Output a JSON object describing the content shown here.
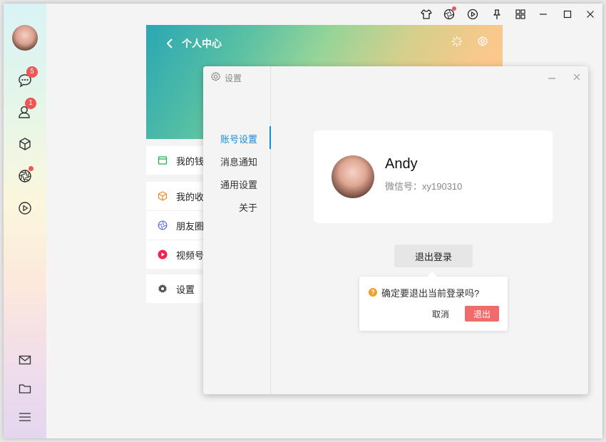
{
  "window": {
    "titlebar_icons": [
      "shirt-icon",
      "aperture-icon",
      "play-circle-icon",
      "pin-icon",
      "grid-icon",
      "minimize-icon",
      "maximize-icon",
      "close-icon"
    ]
  },
  "sidebar": {
    "items": [
      {
        "icon": "chat-icon",
        "badge": "5"
      },
      {
        "icon": "contacts-icon",
        "badge": "1"
      },
      {
        "icon": "cube-icon"
      },
      {
        "icon": "aperture-icon"
      },
      {
        "icon": "play-circle-icon"
      }
    ],
    "bottom_items": [
      {
        "icon": "mail-icon"
      },
      {
        "icon": "folder-icon"
      },
      {
        "icon": "menu-icon"
      }
    ]
  },
  "profile": {
    "title": "个人中心",
    "menu": [
      {
        "label": "我的钱",
        "icon": "wallet-icon",
        "color": "#20b14a"
      },
      {
        "label": "我的收",
        "icon": "cube-icon",
        "color": "#f08a24"
      },
      {
        "label": "朋友圈",
        "icon": "aperture-icon",
        "color": "#5b6ee1"
      },
      {
        "label": "视频号",
        "icon": "play-circle-icon",
        "color": "#f0244f"
      },
      {
        "label": "设置",
        "icon": "gear-icon",
        "color": "#555555"
      }
    ]
  },
  "settings_dialog": {
    "title": "设置",
    "nav": [
      {
        "label": "账号设置",
        "active": true
      },
      {
        "label": "消息通知",
        "active": false
      },
      {
        "label": "通用设置",
        "active": false
      },
      {
        "label": "关于",
        "active": false
      }
    ],
    "account": {
      "name": "Andy",
      "wechat_id": "微信号：xy190310"
    },
    "logout_label": "退出登录",
    "confirm": {
      "message": "确定要退出当前登录吗?",
      "cancel_label": "取消",
      "confirm_label": "退出"
    }
  }
}
